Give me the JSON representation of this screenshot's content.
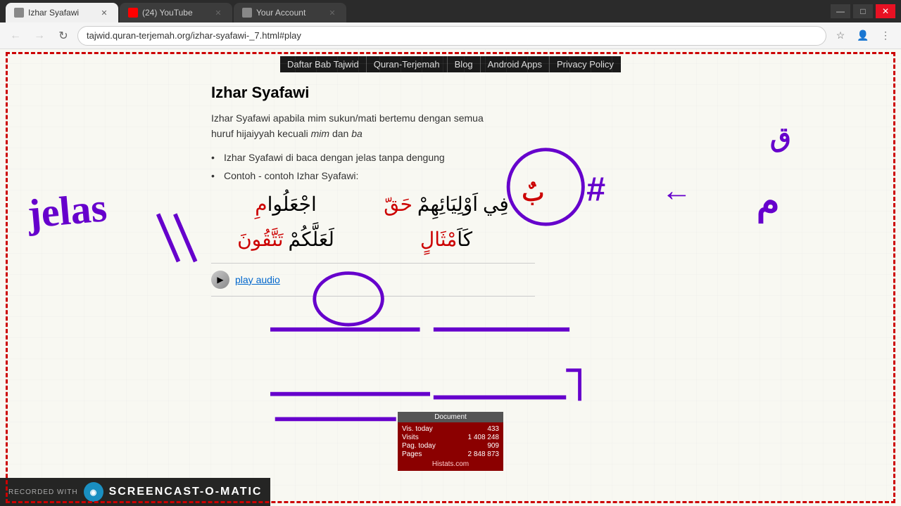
{
  "browser": {
    "tabs": [
      {
        "id": "tab1",
        "title": "Izhar Syafawi",
        "favicon": "page",
        "active": true
      },
      {
        "id": "tab2",
        "title": "(24) YouTube",
        "favicon": "youtube",
        "active": false
      },
      {
        "id": "tab3",
        "title": "Your Account",
        "favicon": "page",
        "active": false
      }
    ],
    "url": "tajwid.quran-terjemah.org/izhar-syafawi-_7.html#play",
    "controls": {
      "minimize": "—",
      "maximize": "□",
      "close": "✕"
    }
  },
  "nav": {
    "items": [
      "Daftar Bab Tajwid",
      "Quran-Terjemah",
      "Blog",
      "Android Apps",
      "Privacy Policy"
    ]
  },
  "page": {
    "title": "Izhar Syafawi",
    "intro": "Izhar Syafawi apabila mim sukun/mati bertemu dengan semua huruf hijaiyyah kecuali",
    "intro_em1": "mim",
    "intro_and": " dan ",
    "intro_em2": "ba",
    "bullet1": "Izhar Syafawi di baca dengan jelas tanpa dengung",
    "bullet2": "Contoh - contoh Izhar Syafawi:",
    "play_text": "play audio"
  },
  "stats": {
    "title": "Document",
    "vis_today_label": "Vis. today",
    "vis_today_val": "433",
    "visits_label": "Visits",
    "visits_val": "1 408 248",
    "pag_today_label": "Pag. today",
    "pag_today_val": "909",
    "pages_label": "Pages",
    "pages_val": "2 848 873",
    "link": "Histats.com"
  },
  "screencast": {
    "recorded_with": "RECORDED WITH",
    "brand": "SCREENCAST-O-MATIC"
  }
}
